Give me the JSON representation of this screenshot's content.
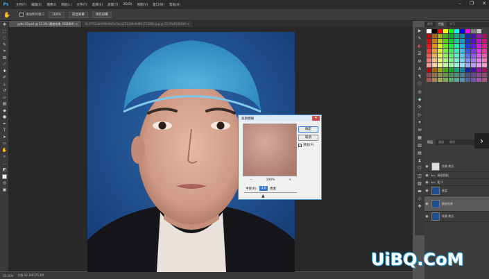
{
  "app": {
    "logo": "Ps"
  },
  "menu": {
    "items": [
      "文件(F)",
      "编辑(E)",
      "图像(I)",
      "图层(L)",
      "文字(Y)",
      "选择(S)",
      "滤镜(T)",
      "3D(D)",
      "视图(V)",
      "窗口(W)",
      "帮助(H)"
    ]
  },
  "window_controls": {
    "minimize": "–",
    "restore": "❐",
    "close": "✕"
  },
  "options": {
    "tool_icon": "hand-icon",
    "scroll_all_label": "滚动所有窗口",
    "zoom_label": "100%",
    "fit_screen_label": "适合屏幕",
    "fill_screen_label": "填充屏幕"
  },
  "tabs": [
    {
      "label": "yyds-10.psd @ 33.3% (磨皮效果, RGB/8#) ×",
      "active": true
    },
    {
      "label": "0c1f761ab6f98e9bf5e5bca231184e0d96171380b.jpg @ 33.3%(RGB/8#) ×",
      "active": false
    }
  ],
  "status": {
    "zoom": "33.33%",
    "doc": "文档:10.1M/375.4M"
  },
  "right_panels": {
    "top_tabs": [
      "颜色",
      "色板",
      "学习"
    ],
    "top_active": "色板",
    "layers_tabs": [
      "图层",
      "通道",
      "路径"
    ],
    "layers_active": "图层",
    "layers": [
      {
        "name": "背景 拷贝",
        "selected": false
      },
      {
        "name": "高低频组",
        "selected": false,
        "group": true
      },
      {
        "name": "组 1",
        "selected": false,
        "group": true
      },
      {
        "name": "底层",
        "selected": false
      },
      {
        "name": "磨皮效果",
        "selected": true
      },
      {
        "name": "背景 拷贝",
        "selected": false
      }
    ]
  },
  "dialog": {
    "title": "高斯模糊",
    "ok_label": "确定",
    "cancel_label": "取消",
    "preview_label": "预览(P)",
    "preview_checked": "✓",
    "zoom_out": "−",
    "zoom_value": "100%",
    "zoom_in": "+",
    "radius_label": "半径(R):",
    "radius_value": "3.0",
    "radius_unit": "像素"
  },
  "watermark": "UiBQ.CoM",
  "colors": {
    "accent": "#31a8ff",
    "canvas_bg": "#282828",
    "panel_bg": "#3c3c3c",
    "backdrop_blue": "#1f4f8e"
  }
}
